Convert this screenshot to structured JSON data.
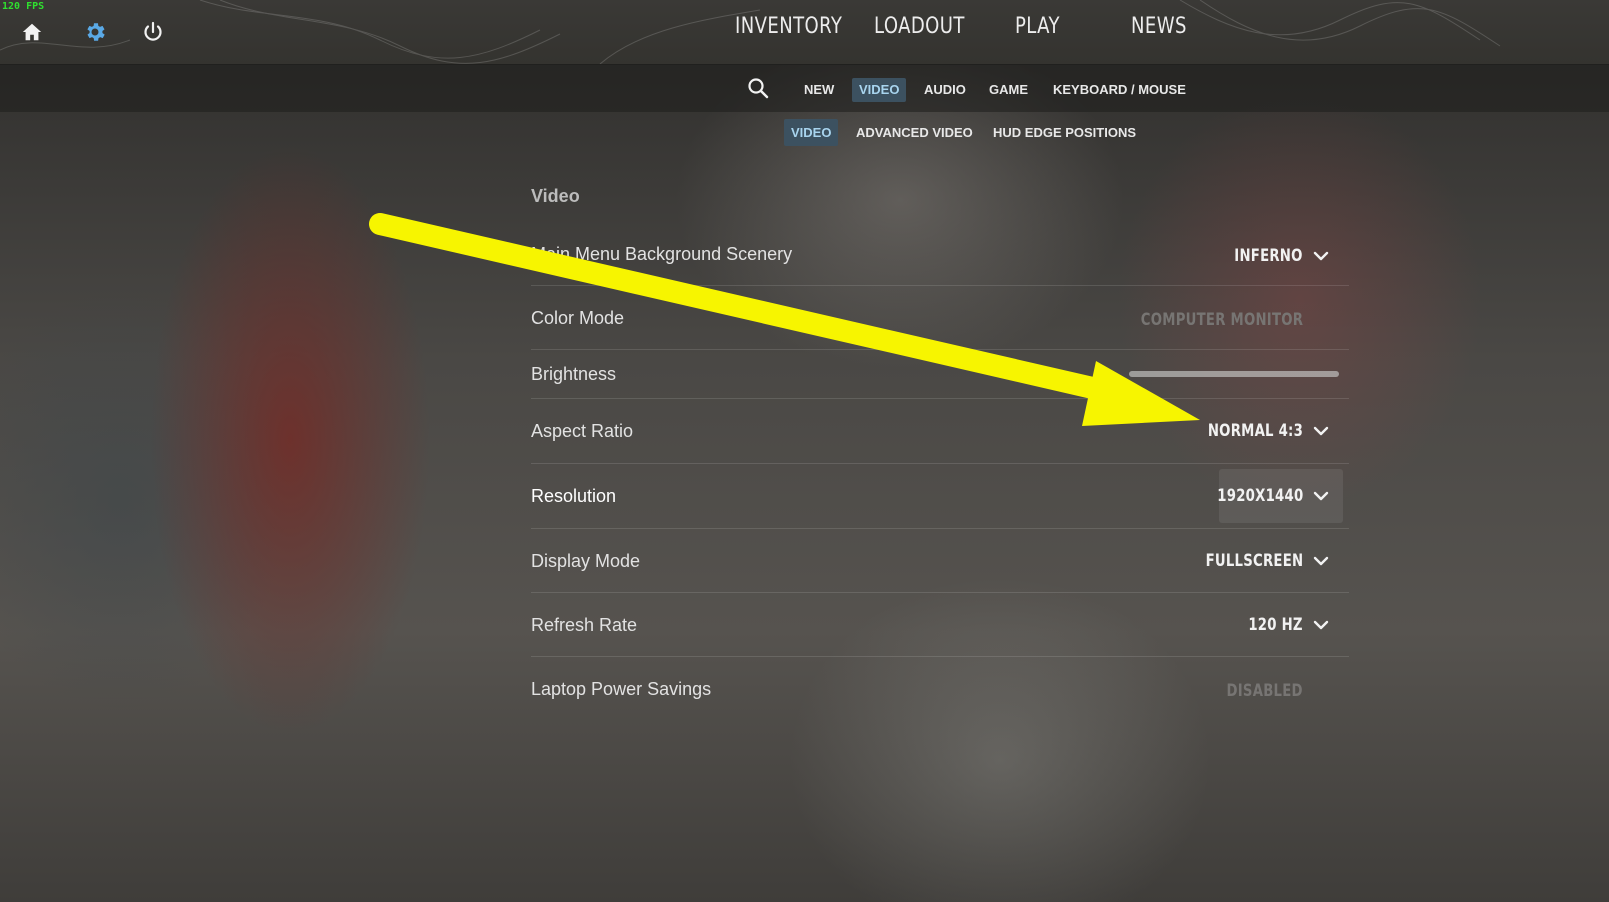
{
  "overlay": {
    "fps": "120 FPS"
  },
  "topbar": {
    "icons": [
      "home-icon",
      "gear-icon",
      "power-icon"
    ],
    "nav": [
      "INVENTORY",
      "LOADOUT",
      "PLAY",
      "NEWS"
    ]
  },
  "settings_tabs": {
    "search_icon": "search-icon",
    "tabs": [
      "NEW",
      "VIDEO",
      "AUDIO",
      "GAME",
      "KEYBOARD / MOUSE"
    ],
    "active": "VIDEO"
  },
  "video_tabs": {
    "tabs": [
      "VIDEO",
      "ADVANCED VIDEO",
      "HUD EDGE POSITIONS"
    ],
    "active": "VIDEO"
  },
  "section": {
    "title": "Video",
    "rows": [
      {
        "label": "Main Menu Background Scenery",
        "value": "INFERNO"
      },
      {
        "label": "Color Mode",
        "value": "COMPUTER MONITOR"
      },
      {
        "label": "Brightness",
        "slider_level": 1.0
      },
      {
        "label": "Aspect Ratio",
        "value": "NORMAL 4:3"
      },
      {
        "label": "Resolution",
        "value": "1920X1440"
      },
      {
        "label": "Display Mode",
        "value": "FULLSCREEN"
      },
      {
        "label": "Refresh Rate",
        "value": "120 HZ"
      },
      {
        "label": "Laptop Power Savings",
        "value": "DISABLED"
      }
    ]
  },
  "annotation": {
    "arrow_color": "#f7f500"
  },
  "colors": {
    "active_tab_bg": "#3c5160",
    "active_tab_text": "#a8d4ee",
    "settings_icon": "#5aa9e6",
    "fps_text": "#2fe02f"
  }
}
